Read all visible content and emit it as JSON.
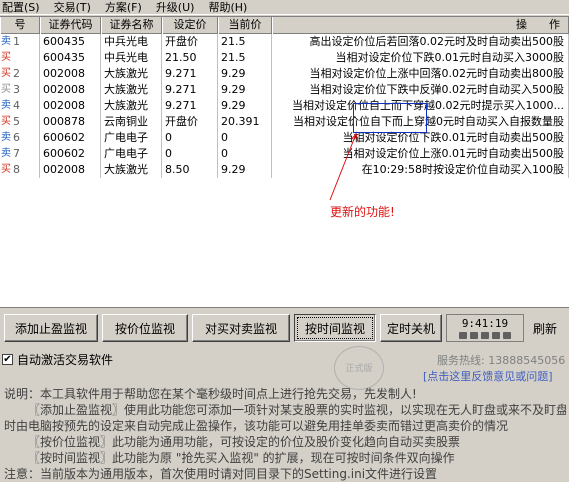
{
  "menu": [
    {
      "label": "配置(S)"
    },
    {
      "label": "交易(T)"
    },
    {
      "label": "方案(F)"
    },
    {
      "label": "升级(U)"
    },
    {
      "label": "帮助(H)"
    }
  ],
  "table": {
    "columns": [
      "号",
      "证券代码",
      "证券名称",
      "设定价",
      "当前价",
      "操　　作"
    ],
    "rows": [
      {
        "mark": "卖",
        "mark_type": "sell",
        "idx": "1",
        "code": "600435",
        "name": "中兵光电",
        "set": "开盘价",
        "cur": "21.5",
        "op": "高出设定价位后若回落0.02元时及时自动卖出500股"
      },
      {
        "mark": "买",
        "mark_type": "buy",
        "idx": "",
        "code": "600435",
        "name": "中兵光电",
        "set": "21.50",
        "cur": "21.5",
        "op": "当相对设定价位下跌0.01元时自动买入3000股"
      },
      {
        "mark": "买",
        "mark_type": "buy",
        "idx": "2",
        "code": "002008",
        "name": "大族激光",
        "set": "9.271",
        "cur": "9.29",
        "op": "当相对设定价位上涨中回落0.02元时自动卖出800股"
      },
      {
        "mark": "买",
        "mark_type": "gray",
        "idx": "3",
        "code": "002008",
        "name": "大族激光",
        "set": "9.271",
        "cur": "9.29",
        "op": "当相对设定价位下跌中反弹0.02元时自动买入500股"
      },
      {
        "mark": "卖",
        "mark_type": "sell",
        "idx": "4",
        "code": "002008",
        "name": "大族激光",
        "set": "9.271",
        "cur": "9.29",
        "op": "当相对设定价位自上而下穿越0.02元时提示买入1000..."
      },
      {
        "mark": "买",
        "mark_type": "buy",
        "idx": "5",
        "code": "000878",
        "name": "云南铜业",
        "set": "开盘价",
        "cur": "20.391",
        "op": "当相对设定价位自下而上穿越0元时自动买入自报数量股"
      },
      {
        "mark": "卖",
        "mark_type": "sell",
        "idx": "6",
        "code": "600602",
        "name": "广电电子",
        "set": "0",
        "cur": "0",
        "op": "当相对设定价位下跌0.01元时自动卖出500股"
      },
      {
        "mark": "卖",
        "mark_type": "sell",
        "idx": "7",
        "code": "600602",
        "name": "广电电子",
        "set": "0",
        "cur": "0",
        "op": "当相对设定价位上涨0.01元时自动卖出500股"
      },
      {
        "mark": "买",
        "mark_type": "buy",
        "idx": "8",
        "code": "002008",
        "name": "大族激光",
        "set": "8.50",
        "cur": "9.29",
        "op": "在10:29:58时按设定价位自动买入100股"
      }
    ]
  },
  "annotation": {
    "text": "更新的功能!",
    "color": "#e01010",
    "box_color": "#1030c0"
  },
  "toolbar": {
    "buttons": [
      {
        "label": "添加止盈监视"
      },
      {
        "label": "按价位监视"
      },
      {
        "label": "对买对卖监视"
      },
      {
        "label": "按时间监视"
      },
      {
        "label": "定时关机"
      }
    ],
    "clock": "9:41:19",
    "refresh": "刷新"
  },
  "auto": {
    "label": "自动激活交易软件",
    "checked": true
  },
  "stamp": "正式版",
  "hotline": "服务热线: 13888545056",
  "feedback": "[点击这里反馈意见或问题]",
  "description": [
    "说明：本工具软件用于帮助您在某个毫秒级时间点上进行抢先交易，先发制人!",
    "〖添加止盈监视〗使用此功能您可添加一项针对某支股票的实时监视，以实现在无人盯盘或来不及盯盘",
    "时由电脑按预先的设定来自动完成止盈操作，该功能可以避免用挂单委卖而错过更高卖价的情况",
    "〖按价位监视〗此功能为通用功能，可按设定的价位及股价变化趋向自动买卖股票",
    "〖按时间监视〗此功能为原 \"抢先买入监视\" 的扩展，现在可按时间条件双向操作",
    "注意：当前版本为通用版本，首次使用时请对同目录下的Setting.ini文件进行设置"
  ]
}
